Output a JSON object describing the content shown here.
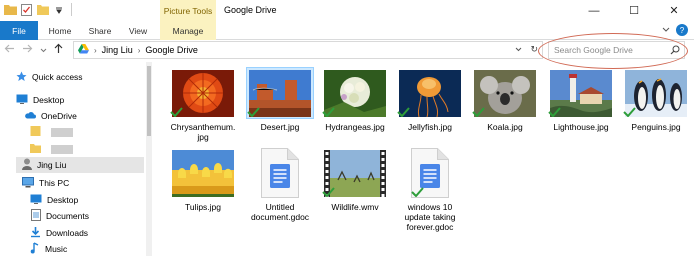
{
  "window": {
    "title": "Google Drive",
    "context_tab": "Picture Tools",
    "minimize": "—",
    "maximize": "☐",
    "close": "✕"
  },
  "ribbon": {
    "tabs": [
      "File",
      "Home",
      "Share",
      "View",
      "Manage"
    ],
    "help": "?"
  },
  "address": {
    "crumbs": [
      "Jing Liu",
      "Google Drive"
    ],
    "refresh": "↻"
  },
  "search": {
    "placeholder": "Search Google Drive"
  },
  "sidebar": {
    "items": [
      {
        "label": "Quick access",
        "icon": "star-icon"
      },
      {
        "label": "Desktop",
        "icon": "desktop-icon"
      },
      {
        "label": "OneDrive",
        "icon": "cloud-icon"
      },
      {
        "label": "",
        "icon": "folder-icon"
      },
      {
        "label": "",
        "icon": "folder-icon"
      },
      {
        "label": "Jing Liu",
        "icon": "user-icon"
      },
      {
        "label": "This PC",
        "icon": "computer-icon"
      },
      {
        "label": "Desktop",
        "icon": "desktop-icon"
      },
      {
        "label": "Documents",
        "icon": "documents-icon"
      },
      {
        "label": "Downloads",
        "icon": "download-icon"
      },
      {
        "label": "Music",
        "icon": "music-icon"
      }
    ]
  },
  "files": [
    {
      "name": "Chrysanthemum.\njpg",
      "kind": "image",
      "theme": "chrysanthemum"
    },
    {
      "name": "Desert.jpg",
      "kind": "image",
      "theme": "desert"
    },
    {
      "name": "Hydrangeas.jpg",
      "kind": "image",
      "theme": "hydrangeas"
    },
    {
      "name": "Jellyfish.jpg",
      "kind": "image",
      "theme": "jellyfish"
    },
    {
      "name": "Koala.jpg",
      "kind": "image",
      "theme": "koala"
    },
    {
      "name": "Lighthouse.jpg",
      "kind": "image",
      "theme": "lighthouse"
    },
    {
      "name": "Penguins.jpg",
      "kind": "image",
      "theme": "penguins"
    },
    {
      "name": "Tulips.jpg",
      "kind": "image",
      "theme": "tulips"
    },
    {
      "name": "Untitled\ndocument.gdoc",
      "kind": "gdoc"
    },
    {
      "name": "Wildlife.wmv",
      "kind": "video"
    },
    {
      "name": "windows 10\nupdate taking\nforever.gdoc",
      "kind": "gdoc"
    }
  ],
  "colors": {
    "file_tab": "#1979ca",
    "context_tab": "#fbf2c0",
    "sync_check": "#2e9e3a",
    "gdoc_blue": "#4a86e8",
    "highlight_oval": "#d16a55"
  }
}
